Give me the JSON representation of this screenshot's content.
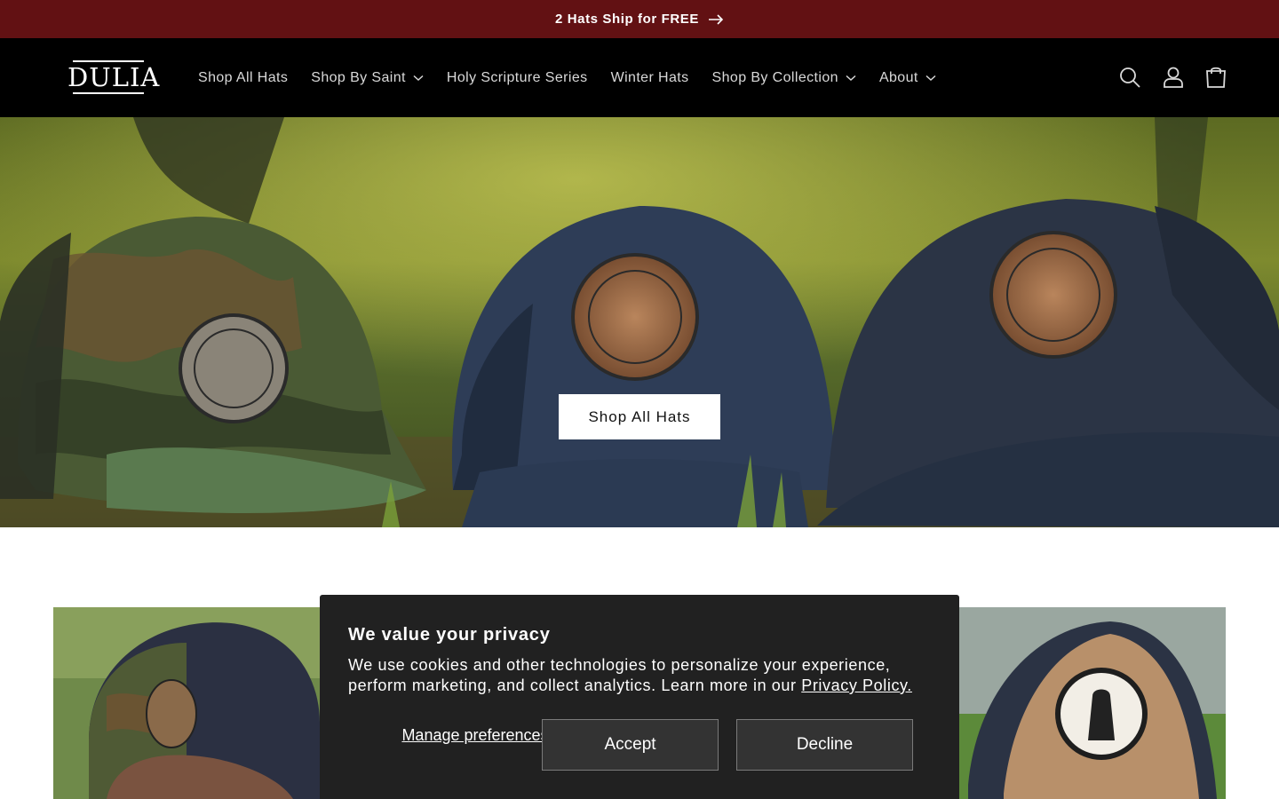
{
  "announcement": {
    "text": "2 Hats Ship for FREE",
    "icon": "arrow-right-icon",
    "background": "#621113"
  },
  "header": {
    "logo_text": "DULIA",
    "nav": [
      {
        "label": "Shop All Hats",
        "has_dropdown": false
      },
      {
        "label": "Shop By Saint",
        "has_dropdown": true
      },
      {
        "label": "Holy Scripture Series",
        "has_dropdown": false
      },
      {
        "label": "Winter Hats",
        "has_dropdown": false
      },
      {
        "label": "Shop By Collection",
        "has_dropdown": true
      },
      {
        "label": "About",
        "has_dropdown": true
      }
    ],
    "icons": [
      "search-icon",
      "account-icon",
      "cart-icon"
    ]
  },
  "hero": {
    "button_label": "Shop All Hats"
  },
  "cookie": {
    "title": "We value your privacy",
    "body": "We use cookies and other technologies to personalize your experience, perform marketing, and collect analytics. Learn more in our ",
    "link": "Privacy Policy.",
    "manage_label": "Manage preferences",
    "accept_label": "Accept",
    "decline_label": "Decline"
  }
}
